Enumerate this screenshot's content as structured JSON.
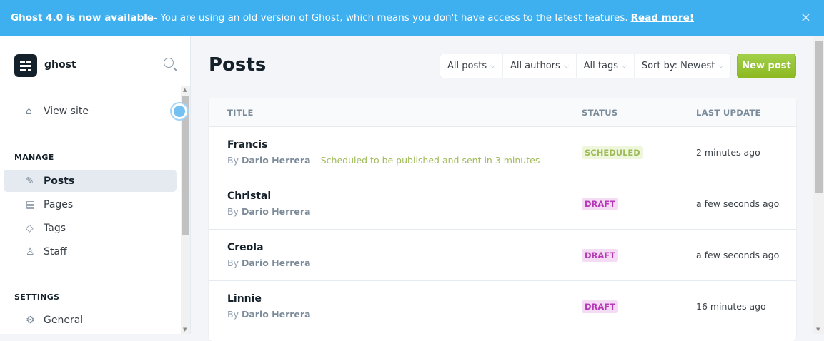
{
  "banner": {
    "bold": "Ghost 4.0 is now available",
    "text": " - You are using an old version of Ghost, which means you don't have access to the latest features.",
    "link": "Read more!",
    "close": "×"
  },
  "sidebar": {
    "brand": "ghost",
    "view_site": "View site",
    "manage_label": "MANAGE",
    "settings_label": "SETTINGS",
    "items": [
      {
        "label": "Posts",
        "icon": "posts-icon"
      },
      {
        "label": "Pages",
        "icon": "pages-icon"
      },
      {
        "label": "Tags",
        "icon": "tag-icon"
      },
      {
        "label": "Staff",
        "icon": "staff-icon"
      }
    ],
    "settings_items": [
      {
        "label": "General",
        "icon": "gear-icon"
      }
    ]
  },
  "main": {
    "title": "Posts",
    "filters": [
      "All posts",
      "All authors",
      "All tags",
      "Sort by: Newest"
    ],
    "new_post": "New post",
    "columns": [
      "TITLE",
      "STATUS",
      "LAST UPDATE"
    ],
    "rows": [
      {
        "title": "Francis",
        "by": "By",
        "author": "Dario Herrera",
        "note": " – Scheduled to be published and sent in 3 minutes",
        "status": "SCHEDULED",
        "updated": "2 minutes ago"
      },
      {
        "title": "Christal",
        "by": "By",
        "author": "Dario Herrera",
        "note": "",
        "status": "DRAFT",
        "updated": "a few seconds ago"
      },
      {
        "title": "Creola",
        "by": "By",
        "author": "Dario Herrera",
        "note": "",
        "status": "DRAFT",
        "updated": "a few seconds ago"
      },
      {
        "title": "Linnie",
        "by": "By",
        "author": "Dario Herrera",
        "note": "",
        "status": "DRAFT",
        "updated": "16 minutes ago"
      }
    ]
  },
  "colors": {
    "banner": "#3eb0ef",
    "accent_green": "#9fbb58",
    "draft": "#b638b6"
  }
}
